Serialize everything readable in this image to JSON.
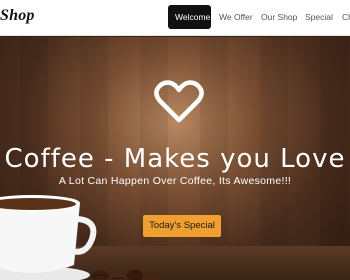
{
  "header": {
    "brand": "Shop",
    "nav": [
      {
        "label": "Welcome",
        "active": true
      },
      {
        "label": "We Offer",
        "active": false
      },
      {
        "label": "Our Shop",
        "active": false
      },
      {
        "label": "Special",
        "active": false
      },
      {
        "label": "Che",
        "active": false
      }
    ]
  },
  "hero": {
    "icon": "heart-outline-icon",
    "title": "Coffee - Makes you Love",
    "subtitle": "A Lot Can Happen Over Coffee, Its Awesome!!!",
    "cta_label": "Today's Special"
  },
  "colors": {
    "accent": "#f0a030",
    "nav_active_bg": "#111111",
    "hero_text": "#ffffff"
  }
}
